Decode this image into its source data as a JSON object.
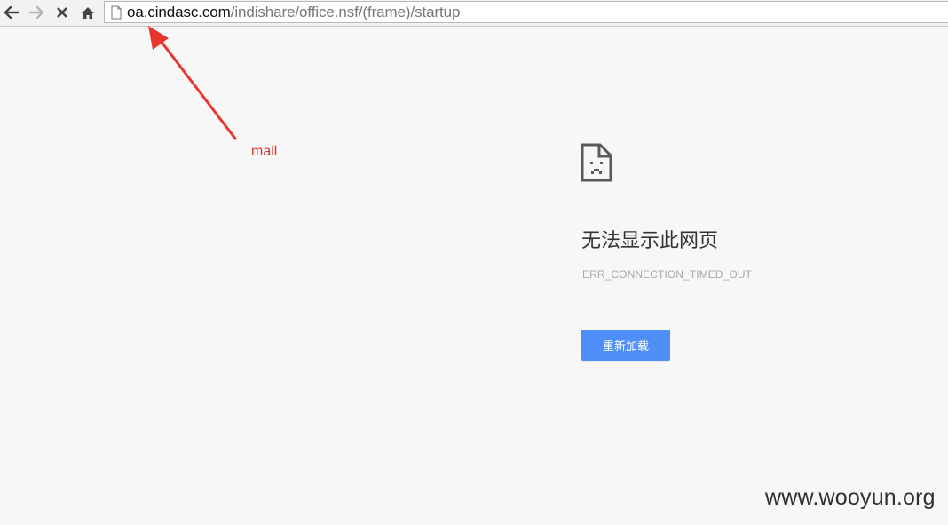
{
  "browser": {
    "back_icon": "back-arrow-icon",
    "forward_icon": "forward-arrow-icon",
    "stop_icon": "close-icon",
    "home_icon": "home-icon",
    "page_icon": "page-icon",
    "url_host": "oa.cindasc.com",
    "url_path": "/indishare/office.nsf/(frame)/startup"
  },
  "annotation": {
    "label": "mail",
    "color": "#e0332e"
  },
  "error_page": {
    "icon": "sad-page-icon",
    "title": "无法显示此网页",
    "error_code": "ERR_CONNECTION_TIMED_OUT",
    "reload_label": "重新加载",
    "button_color": "#4e8ef7"
  },
  "watermark": {
    "text": "www.wooyun.org"
  }
}
